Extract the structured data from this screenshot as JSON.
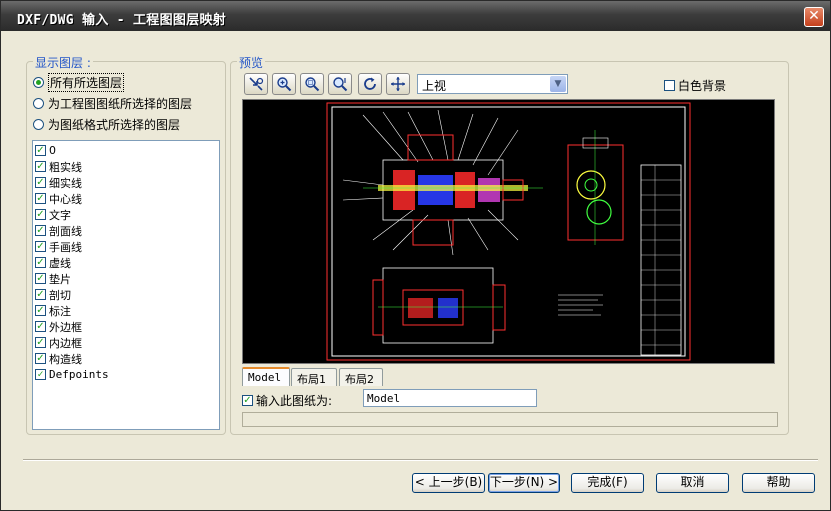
{
  "window": {
    "title": "DXF/DWG 输入 - 工程图图层映射",
    "close_glyph": "✕"
  },
  "display_layers": {
    "label": "显示图层 :",
    "options": [
      {
        "label": "所有所选图层",
        "selected": true
      },
      {
        "label": "为工程图图纸所选择的图层",
        "selected": false
      },
      {
        "label": "为图纸格式所选择的图层",
        "selected": false
      }
    ],
    "layers": [
      {
        "name": "0",
        "checked": true
      },
      {
        "name": "粗实线",
        "checked": true
      },
      {
        "name": "细实线",
        "checked": true
      },
      {
        "name": "中心线",
        "checked": true
      },
      {
        "name": "文字",
        "checked": true
      },
      {
        "name": "剖面线",
        "checked": true
      },
      {
        "name": "手画线",
        "checked": true
      },
      {
        "name": "虚线",
        "checked": true
      },
      {
        "name": "垫片",
        "checked": true
      },
      {
        "name": "剖切",
        "checked": true
      },
      {
        "name": "标注",
        "checked": true
      },
      {
        "name": "外边框",
        "checked": true
      },
      {
        "name": "内边框",
        "checked": true
      },
      {
        "name": "构造线",
        "checked": true
      },
      {
        "name": "Defpoints",
        "checked": true
      }
    ]
  },
  "preview": {
    "label": "预览",
    "toolbar_icons": [
      "zoom-to-fit-icon",
      "zoom-in-out-icon",
      "zoom-window-icon",
      "zoom-area-icon",
      "rotate-icon",
      "pan-icon"
    ],
    "view_select": {
      "value": "上视",
      "arrow": "▼"
    },
    "white_bg_label": "白色背景",
    "white_bg_checked": false,
    "tabs": [
      "Model",
      "布局1",
      "布局2"
    ],
    "active_tab": "Model",
    "import_sheet_label": "输入此图纸为:",
    "import_sheet_checked": true,
    "sheet_name": "Model"
  },
  "buttons": {
    "back": "< 上一步(B)",
    "next": "下一步(N) >",
    "finish": "完成(F)",
    "cancel": "取消",
    "help": "帮助"
  },
  "colors": {
    "group_label": "#2456c8",
    "check_green": "#21a121",
    "dialog_bg": "#ECE9D8",
    "preview_bg": "#000000"
  }
}
